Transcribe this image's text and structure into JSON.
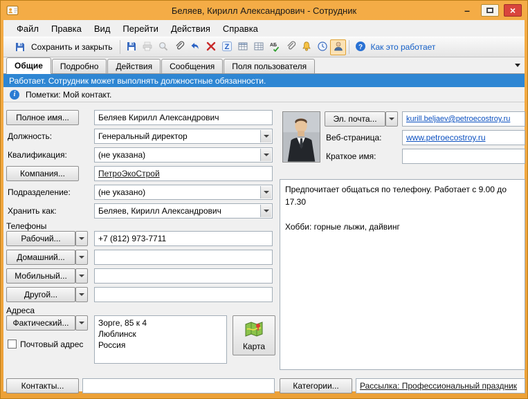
{
  "window": {
    "title": "Беляев, Кирилл Александрович - Сотрудник",
    "minimize_glyph": "–",
    "close_glyph": "×"
  },
  "menu": {
    "items": [
      "Файл",
      "Правка",
      "Вид",
      "Перейти",
      "Действия",
      "Справка"
    ]
  },
  "toolbar": {
    "save_close_label": "Сохранить и закрыть",
    "help_label": "Как это работает",
    "icons": {
      "save-icon": "floppy-disk",
      "print-icon": "printer",
      "preview-icon": "magnifier",
      "attach-icon": "paperclip",
      "undo-icon": "curved-blue-arrow",
      "delete-icon": "red-x",
      "autotext-icon": "letter-z-box",
      "table-icon": "table-grid",
      "grid-icon": "table-grid-plain",
      "spellcheck-icon": "abc-green-check",
      "attach-item-icon": "paperclip",
      "reminder-icon": "yellow-bell",
      "recurrence-icon": "blue-clock",
      "contact-icon": "person-silhouette",
      "help-icon": "blue-question-circle"
    }
  },
  "tabs": [
    {
      "label": "Общие"
    },
    {
      "label": "Подробно"
    },
    {
      "label": "Действия"
    },
    {
      "label": "Сообщения"
    },
    {
      "label": "Поля пользователя"
    }
  ],
  "banners": {
    "status": "Работает. Сотрудник может выполнять должностные обязанности.",
    "notes": "Пометки: Мой контакт."
  },
  "form": {
    "full_name": {
      "button": "Полное имя...",
      "value": "Беляев Кирилл Александрович"
    },
    "position": {
      "label": "Должность:",
      "value": "Генеральный директор"
    },
    "qualification": {
      "label": "Квалификация:",
      "value": "(не указана)"
    },
    "company": {
      "button": "Компания...",
      "value": "ПетроЭкоСтрой"
    },
    "department": {
      "label": "Подразделение:",
      "value": "(не указано)"
    },
    "file_as": {
      "label": "Хранить как:",
      "value": "Беляев, Кирилл Александрович"
    },
    "phones": {
      "section": "Телефоны",
      "items": [
        {
          "button": "Рабочий...",
          "value": "+7 (812) 973-7711"
        },
        {
          "button": "Домашний...",
          "value": ""
        },
        {
          "button": "Мобильный...",
          "value": ""
        },
        {
          "button": "Другой...",
          "value": ""
        }
      ]
    },
    "addresses": {
      "section": "Адреса",
      "button": "Фактический...",
      "value": "Зорге, 85 к 4\nЛюблинск\nРоссия",
      "postal_checkbox": "Почтовый адрес",
      "map_button": "Карта"
    },
    "email": {
      "button": "Эл. почта...",
      "value": "kurill.beljaev@petroecostroy.ru"
    },
    "web": {
      "label": "Веб-страница:",
      "value": "www.petroecostroy.ru"
    },
    "short_name": {
      "label": "Краткое имя:",
      "value": ""
    },
    "notes": "Предпочитает общаться по телефону. Работает с 9.00 до 17.30\n\nХобби: горные лыжи, дайвинг"
  },
  "bottom": {
    "contacts_label": "Контакты...",
    "contacts_value": "",
    "categories_label": "Категории...",
    "categories_value": "Рассылка: Профессиональный праздник"
  },
  "colors": {
    "frame": "#eda138",
    "status_banner": "#2e86d3",
    "link": "#0b50c0",
    "close_button": "#d9453c"
  }
}
